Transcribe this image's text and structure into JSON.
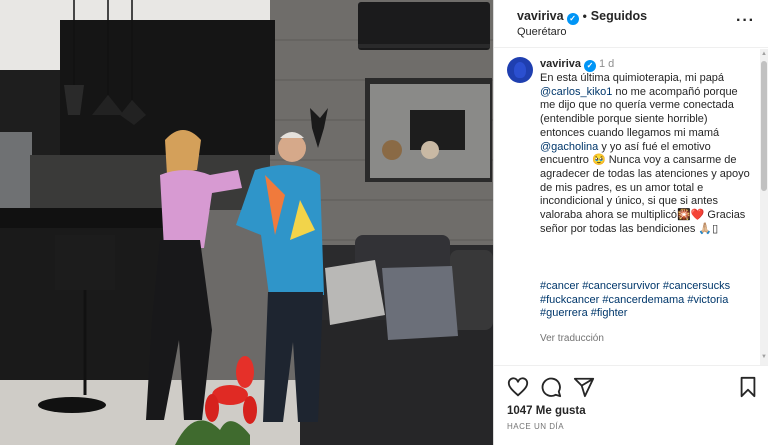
{
  "header": {
    "username": "vaviriva",
    "separator": "•",
    "follow_status": "Seguidos",
    "location": "Querétaro",
    "more_icon": "more-horizontal-icon"
  },
  "post": {
    "username": "vaviriva",
    "time": "1 d",
    "caption_parts": [
      "En esta última quimioterapia, mi papá ",
      "@carlos_kiko1",
      " no me acompañó porque me dijo que no quería verme conectada (entendible porque siente horrible) entonces cuando llegamos mi mamá ",
      "@gacholina",
      " y yo así fué el emotivo encuentro 🥹 Nunca voy a cansarme de agradecer de todas las atenciones y apoyo de mis padres, es un amor total e incondicional y único, si que si antes valoraba ahora se multiplicó🎇❤️ Gracias señor por todas las bendiciones 🙏🏼▯"
    ],
    "hashtags": "#cancer #cancersurvivor #cancersucks #fuckcancer #cancerdemama #victoria #guerrera #fighter",
    "see_translation": "Ver traducción"
  },
  "actions": {
    "icons": [
      "heart-icon",
      "comment-icon",
      "share-icon",
      "bookmark-icon"
    ],
    "likes": "1047 Me gusta",
    "timeago": "HACE UN DÍA"
  },
  "colors": {
    "verified_blue": "#0095f6",
    "link_blue": "#00376b",
    "muted": "#737373",
    "text": "#262626"
  }
}
